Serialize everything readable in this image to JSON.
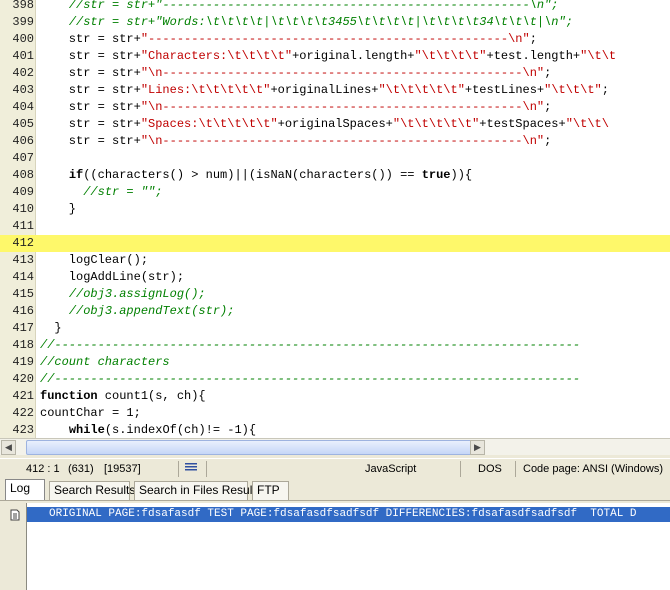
{
  "editor": {
    "highlight_line": "412",
    "lines": [
      {
        "n": "398",
        "segs": [
          [
            "    ",
            ""
          ],
          [
            "//str = str+\"---------------------------------------------------\\n\";",
            "c"
          ]
        ]
      },
      {
        "n": "399",
        "segs": [
          [
            "    ",
            ""
          ],
          [
            "//str = str+\"Words:\\t\\t\\t\\t|\\t\\t\\t\\t3455\\t\\t\\t\\t|\\t\\t\\t\\t34\\t\\t\\t|\\n\";",
            "c"
          ]
        ]
      },
      {
        "n": "400",
        "segs": [
          [
            "    str = str+",
            ""
          ],
          [
            "\"--------------------------------------------------\\n\"",
            "s"
          ],
          [
            ";",
            ""
          ]
        ]
      },
      {
        "n": "401",
        "segs": [
          [
            "    str = str+",
            ""
          ],
          [
            "\"Characters:\\t\\t\\t\\t\"",
            "s"
          ],
          [
            "+original.length+",
            ""
          ],
          [
            "\"\\t\\t\\t\\t\"",
            "s"
          ],
          [
            "+test.length+",
            ""
          ],
          [
            "\"\\t\\t",
            "s"
          ]
        ]
      },
      {
        "n": "402",
        "segs": [
          [
            "    str = str+",
            ""
          ],
          [
            "\"\\n--------------------------------------------------\\n\"",
            "s"
          ],
          [
            ";",
            ""
          ]
        ]
      },
      {
        "n": "403",
        "segs": [
          [
            "    str = str+",
            ""
          ],
          [
            "\"Lines:\\t\\t\\t\\t\\t\"",
            "s"
          ],
          [
            "+originalLines+",
            ""
          ],
          [
            "\"\\t\\t\\t\\t\\t\"",
            "s"
          ],
          [
            "+testLines+",
            ""
          ],
          [
            "\"\\t\\t\\t\"",
            "s"
          ],
          [
            ";",
            ""
          ]
        ]
      },
      {
        "n": "404",
        "segs": [
          [
            "    str = str+",
            ""
          ],
          [
            "\"\\n--------------------------------------------------\\n\"",
            "s"
          ],
          [
            ";",
            ""
          ]
        ]
      },
      {
        "n": "405",
        "segs": [
          [
            "    str = str+",
            ""
          ],
          [
            "\"Spaces:\\t\\t\\t\\t\\t\"",
            "s"
          ],
          [
            "+originalSpaces+",
            ""
          ],
          [
            "\"\\t\\t\\t\\t\\t\"",
            "s"
          ],
          [
            "+testSpaces+",
            ""
          ],
          [
            "\"\\t\\t\\",
            "s"
          ]
        ]
      },
      {
        "n": "406",
        "segs": [
          [
            "    str = str+",
            ""
          ],
          [
            "\"\\n--------------------------------------------------\\n\"",
            "s"
          ],
          [
            ";",
            ""
          ]
        ]
      },
      {
        "n": "407",
        "segs": []
      },
      {
        "n": "408",
        "segs": [
          [
            "    ",
            ""
          ],
          [
            "if",
            "k"
          ],
          [
            "((characters() > num)||(isNaN(characters()) == ",
            ""
          ],
          [
            "true",
            "k"
          ],
          [
            ")){",
            ""
          ]
        ]
      },
      {
        "n": "409",
        "segs": [
          [
            "      ",
            ""
          ],
          [
            "//str = \"\";",
            "c"
          ]
        ]
      },
      {
        "n": "410",
        "segs": [
          [
            "    }",
            ""
          ]
        ]
      },
      {
        "n": "411",
        "segs": []
      },
      {
        "n": "412",
        "segs": []
      },
      {
        "n": "413",
        "segs": [
          [
            "    logClear();",
            ""
          ]
        ]
      },
      {
        "n": "414",
        "segs": [
          [
            "    logAddLine(str);",
            ""
          ]
        ]
      },
      {
        "n": "415",
        "segs": [
          [
            "    ",
            ""
          ],
          [
            "//obj3.assignLog();",
            "c"
          ]
        ]
      },
      {
        "n": "416",
        "segs": [
          [
            "    ",
            ""
          ],
          [
            "//obj3.appendText(str);",
            "c"
          ]
        ]
      },
      {
        "n": "417",
        "segs": [
          [
            "  }",
            ""
          ]
        ]
      },
      {
        "n": "418",
        "segs": [
          [
            "",
            ""
          ],
          [
            "//-------------------------------------------------------------------------",
            "c"
          ]
        ]
      },
      {
        "n": "419",
        "segs": [
          [
            "",
            ""
          ],
          [
            "//count characters",
            "c"
          ]
        ]
      },
      {
        "n": "420",
        "segs": [
          [
            "",
            ""
          ],
          [
            "//-------------------------------------------------------------------------",
            "c"
          ]
        ]
      },
      {
        "n": "421",
        "segs": [
          [
            "",
            ""
          ],
          [
            "function",
            "k"
          ],
          [
            " count1(s, ch){",
            ""
          ]
        ]
      },
      {
        "n": "422",
        "segs": [
          [
            "countChar = 1;",
            ""
          ]
        ]
      },
      {
        "n": "423",
        "segs": [
          [
            "    ",
            ""
          ],
          [
            "while",
            "k"
          ],
          [
            "(s.indexOf(ch)!= -1){",
            ""
          ]
        ]
      }
    ]
  },
  "statusbar": {
    "position": "412 : 1",
    "chars": "(631)",
    "bytes": "[19537]",
    "syntax": "JavaScript",
    "line_endings": "DOS",
    "codepage": "Code page: ANSI (Windows)"
  },
  "tabs": [
    {
      "label": "Log",
      "active": true
    },
    {
      "label": "Search Results",
      "active": false
    },
    {
      "label": "Search in Files Results",
      "active": false
    },
    {
      "label": "FTP",
      "active": false
    }
  ],
  "log": {
    "line": "ORIGINAL PAGE:fdsafasdf TEST PAGE:fdsafasdfsadfsdf DIFFERENCIES:fdsafasdfsadfsdf  TOTAL D"
  },
  "colors": {
    "highlight": "#fef86a",
    "selection": "#316ac5",
    "comment": "#008000",
    "string": "#c00000"
  }
}
